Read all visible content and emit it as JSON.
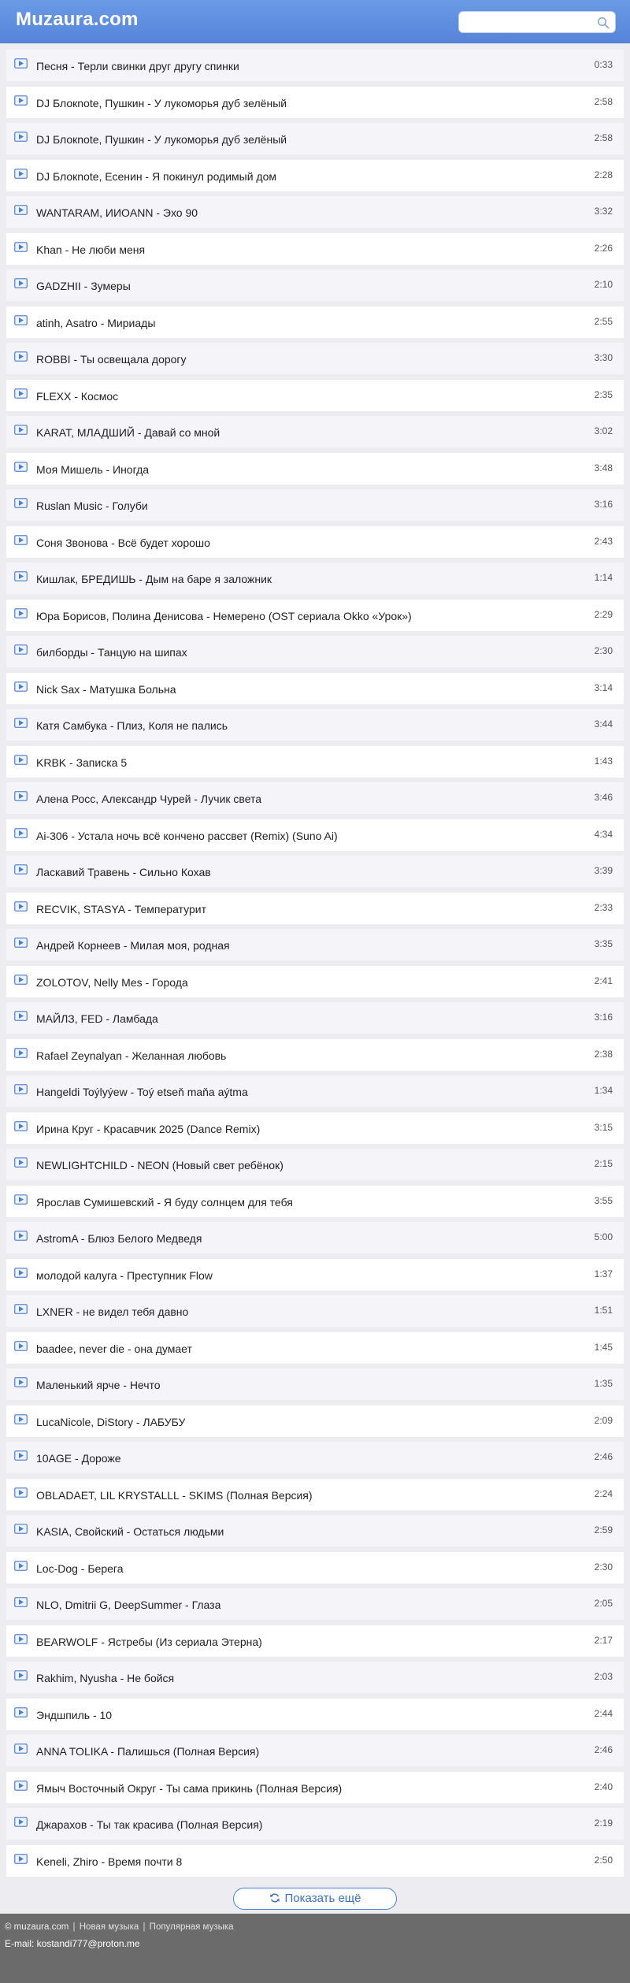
{
  "header": {
    "logo": "Muzaura.com",
    "search_placeholder": ""
  },
  "tracks": [
    {
      "title": "Песня - Терли свинки друг другу спинки",
      "duration": "0:33"
    },
    {
      "title": "DJ Блокnote, Пушкин - У лукоморья дуб зелёный",
      "duration": "2:58"
    },
    {
      "title": "DJ Блокnote, Пушкин - У лукоморья дуб зелёный",
      "duration": "2:58"
    },
    {
      "title": "DJ Блокnote, Есенин - Я покинул родимый дом",
      "duration": "2:28"
    },
    {
      "title": "WANTARAM, ИИОANN - Эхо 90",
      "duration": "3:32"
    },
    {
      "title": "Khan - Не люби меня",
      "duration": "2:26"
    },
    {
      "title": "GADZHII - Зумеры",
      "duration": "2:10"
    },
    {
      "title": "atinh, Asatro - Мириады",
      "duration": "2:55"
    },
    {
      "title": "ROBBI - Ты освещала дорогу",
      "duration": "3:30"
    },
    {
      "title": "FLEXX - Космос",
      "duration": "2:35"
    },
    {
      "title": "KARAT, МЛАДШИЙ - Давай со мной",
      "duration": "3:02"
    },
    {
      "title": "Моя Мишель - Иногда",
      "duration": "3:48"
    },
    {
      "title": "Ruslan Music - Голуби",
      "duration": "3:16"
    },
    {
      "title": "Соня Звонова - Всё будет хорошо",
      "duration": "2:43"
    },
    {
      "title": "Кишлак, БРЕДИШЬ - Дым на баре я заложник",
      "duration": "1:14"
    },
    {
      "title": "Юра Борисов, Полина Денисова - Немерено (OST сериала Okko «Урок»)",
      "duration": "2:29"
    },
    {
      "title": "билборды - Танцую на шипах",
      "duration": "2:30"
    },
    {
      "title": "Nick Sax - Матушка Больна",
      "duration": "3:14"
    },
    {
      "title": "Катя Самбука - Плиз, Коля не пались",
      "duration": "3:44"
    },
    {
      "title": "KRBK - Записка 5",
      "duration": "1:43"
    },
    {
      "title": "Алена Росс, Александр Чурей - Лучик света",
      "duration": "3:46"
    },
    {
      "title": "Ai-306 - Устала ночь всё кончено рассвет (Remix) (Suno Ai)",
      "duration": "4:34"
    },
    {
      "title": "Ласкавий Травень - Сильно Кохав",
      "duration": "3:39"
    },
    {
      "title": "RECVIK, STASYA - Температурит",
      "duration": "2:33"
    },
    {
      "title": "Андрей Корнеев - Милая моя, родная",
      "duration": "3:35"
    },
    {
      "title": "ZOLOTOV, Nelly Mes - Города",
      "duration": "2:41"
    },
    {
      "title": "МАЙЛЗ, FED - Ламбада",
      "duration": "3:16"
    },
    {
      "title": "Rafael Zeynalyan - Желанная любовь",
      "duration": "2:38"
    },
    {
      "title": "Hangeldi Toýlyýew - Toý etseň maňa aýtma",
      "duration": "1:34"
    },
    {
      "title": "Ирина Круг - Красавчик 2025 (Dance Remix)",
      "duration": "3:15"
    },
    {
      "title": "NEWLIGHTCHILD - NEON (Новый свет ребёнок)",
      "duration": "2:15"
    },
    {
      "title": "Ярослав Сумишевский - Я буду солнцем для тебя",
      "duration": "3:55"
    },
    {
      "title": "AstromA - Блюз Белого Медведя",
      "duration": "5:00"
    },
    {
      "title": "молодой калуга - Преступник Flow",
      "duration": "1:37"
    },
    {
      "title": "LXNER - не видел тебя давно",
      "duration": "1:51"
    },
    {
      "title": "baadee, never die - она думает",
      "duration": "1:45"
    },
    {
      "title": "Маленький ярче - Нечто",
      "duration": "1:35"
    },
    {
      "title": "LucaNicole, DiStory - ЛАБУБУ",
      "duration": "2:09"
    },
    {
      "title": "10AGE - Дороже",
      "duration": "2:46"
    },
    {
      "title": "OBLADAET, LIL KRYSTALLL - SKIMS (Полная Версия)",
      "duration": "2:24"
    },
    {
      "title": "KASIA, Свойский - Остаться людьми",
      "duration": "2:59"
    },
    {
      "title": "Loc-Dog - Берега",
      "duration": "2:30"
    },
    {
      "title": "NLO, Dmitrii G, DeepSummer - Глаза",
      "duration": "2:05"
    },
    {
      "title": "BEARWOLF - Ястребы (Из сериала Этерна)",
      "duration": "2:17"
    },
    {
      "title": "Rakhim, Nyusha - Не бойся",
      "duration": "2:03"
    },
    {
      "title": "Эндшпиль - 10",
      "duration": "2:44"
    },
    {
      "title": "ANNA TOLIKA - Палишься (Полная Версия)",
      "duration": "2:46"
    },
    {
      "title": "Ямыч Восточный Округ - Ты сама прикинь (Полная Версия)",
      "duration": "2:40"
    },
    {
      "title": "Джарахов - Ты так красива (Полная Версия)",
      "duration": "2:19"
    },
    {
      "title": "Keneli, Zhiro - Время почти 8",
      "duration": "2:50"
    }
  ],
  "more_button": {
    "label": "Показать ещё",
    "icon": "refresh-icon"
  },
  "footer": {
    "copyright": "© muzaura.com",
    "sep": "|",
    "link_new": "Новая музыка",
    "link_popular": "Популярная музыка",
    "email": "E-mail: kostandi777@proton.me"
  },
  "colors": {
    "header": "#5f8fe0",
    "accent": "#4a7fd6",
    "footer": "#6b6b6b",
    "row_alt": "#f4f4f9"
  }
}
